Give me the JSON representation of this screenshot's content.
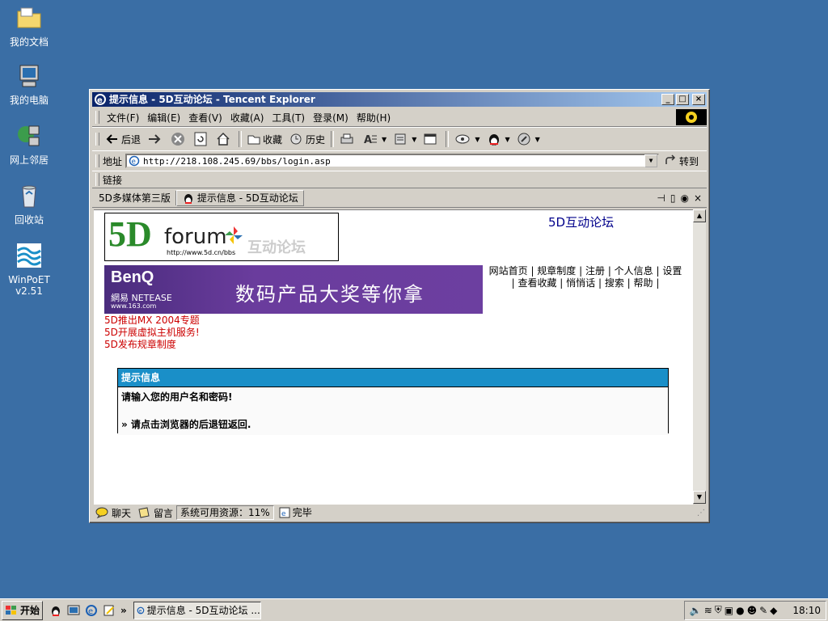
{
  "desktop": {
    "icons": [
      {
        "label": "我的文档"
      },
      {
        "label": "我的电脑"
      },
      {
        "label": "网上邻居"
      },
      {
        "label": "回收站"
      },
      {
        "label": "WinPoET\nv2.51"
      }
    ]
  },
  "window": {
    "title": "提示信息 - 5D互动论坛 - Tencent Explorer",
    "menu": [
      "文件(F)",
      "编辑(E)",
      "查看(V)",
      "收藏(A)",
      "工具(T)",
      "登录(M)",
      "帮助(H)"
    ],
    "toolbar": {
      "back": "后退",
      "favorites": "收藏",
      "history": "历史"
    },
    "address": {
      "label": "地址",
      "url": "http://218.108.245.69/bbs/login.asp",
      "go": "转到"
    },
    "links_label": "链接",
    "tabs": [
      {
        "label": "5D多媒体第三版"
      },
      {
        "label": "提示信息 - 5D互动论坛"
      }
    ],
    "status": {
      "chat": "聊天",
      "message": "留言",
      "resources": "系统可用资源：11%",
      "done": "完毕"
    }
  },
  "page": {
    "logo": {
      "brand": "5D",
      "word": "forum",
      "url": "http://www.5d.cn/bbs",
      "cn": "互动论坛"
    },
    "forum_title": "5D互动论坛",
    "banner": {
      "brand": "BenQ",
      "netease": "網易 NETEASE",
      "url": "www.163.com",
      "slogan": "数码产品大奖等你拿"
    },
    "nav_links": [
      "网站首页",
      "规章制度",
      "注册",
      "个人信息",
      "设置",
      "查看收藏",
      "悄悄话",
      "搜索",
      "帮助"
    ],
    "news": [
      "5D推出MX 2004专题",
      "5D开展虚拟主机服务!",
      "5D发布规章制度"
    ],
    "message": {
      "header": "提示信息",
      "line1": "请输入您的用户名和密码!",
      "line2": "» 请点击浏览器的后退钮返回."
    }
  },
  "taskbar": {
    "start": "开始",
    "task": "提示信息 - 5D互动论坛 ...",
    "clock": "18:10"
  }
}
